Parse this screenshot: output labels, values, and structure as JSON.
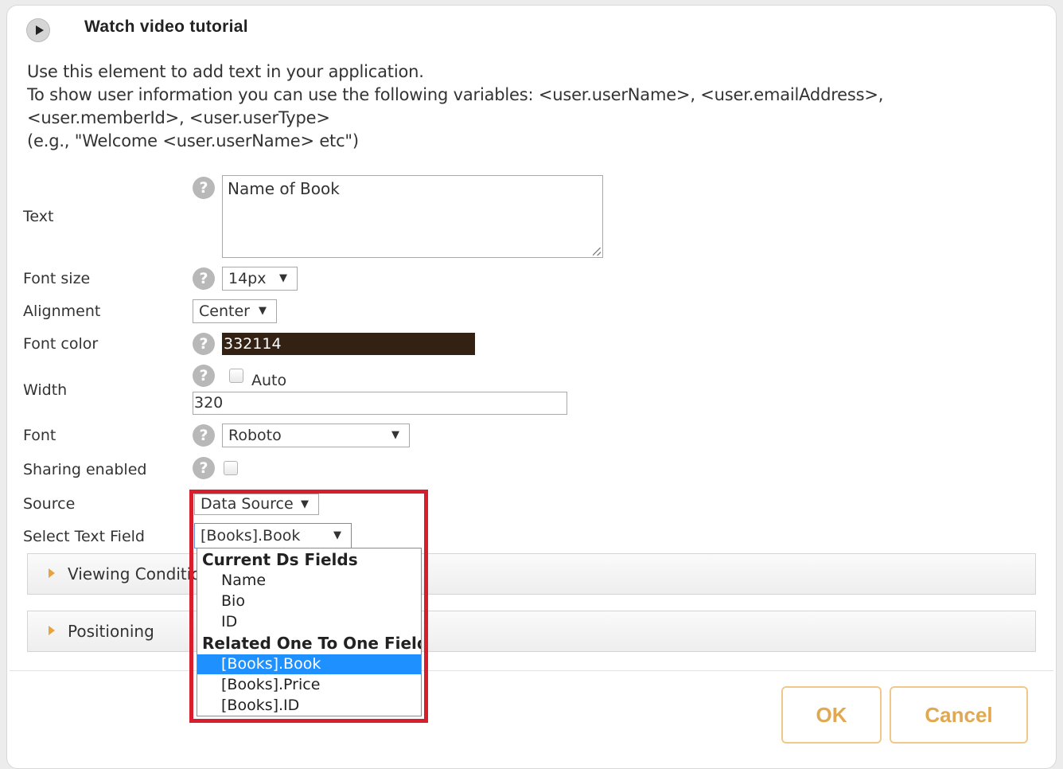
{
  "header": {
    "tutorial_label": "Watch video tutorial"
  },
  "description": {
    "line1": "Use this element to add text in your application.",
    "line2": "To show user information you can use the following variables: <user.userName>, <user.emailAddress>,",
    "line3": "<user.memberId>, <user.userType>",
    "line4": "(e.g., \"Welcome <user.userName> etc\")"
  },
  "help_glyph": "?",
  "fields": {
    "text": {
      "label": "Text",
      "value": "Name of Book"
    },
    "font_size": {
      "label": "Font size",
      "value": "14px"
    },
    "alignment": {
      "label": "Alignment",
      "value": "Center"
    },
    "font_color": {
      "label": "Font color",
      "value": "332114",
      "color": "#332114"
    },
    "width": {
      "label": "Width",
      "auto_label": "Auto",
      "auto_checked": false,
      "value": "320"
    },
    "font": {
      "label": "Font",
      "value": "Roboto"
    },
    "sharing": {
      "label": "Sharing enabled",
      "checked": false
    },
    "source": {
      "label": "Source",
      "value": "Data Source"
    },
    "select_text_field": {
      "label": "Select Text Field",
      "value": "[Books].Book"
    }
  },
  "dropdown": {
    "groups": [
      {
        "label": "Current Ds Fields",
        "options": [
          "Name",
          "Bio",
          "ID"
        ]
      },
      {
        "label": "Related One To One Fields",
        "options": [
          "[Books].Book",
          "[Books].Price",
          "[Books].ID"
        ]
      }
    ],
    "selected": "[Books].Book",
    "highlight_color": "#d81e2c",
    "selected_color": "#1e90ff"
  },
  "sections": {
    "viewing_conditions": "Viewing Conditions",
    "positioning": "Positioning"
  },
  "buttons": {
    "ok": "OK",
    "cancel": "Cancel"
  },
  "dropdown_arrow": "▼"
}
